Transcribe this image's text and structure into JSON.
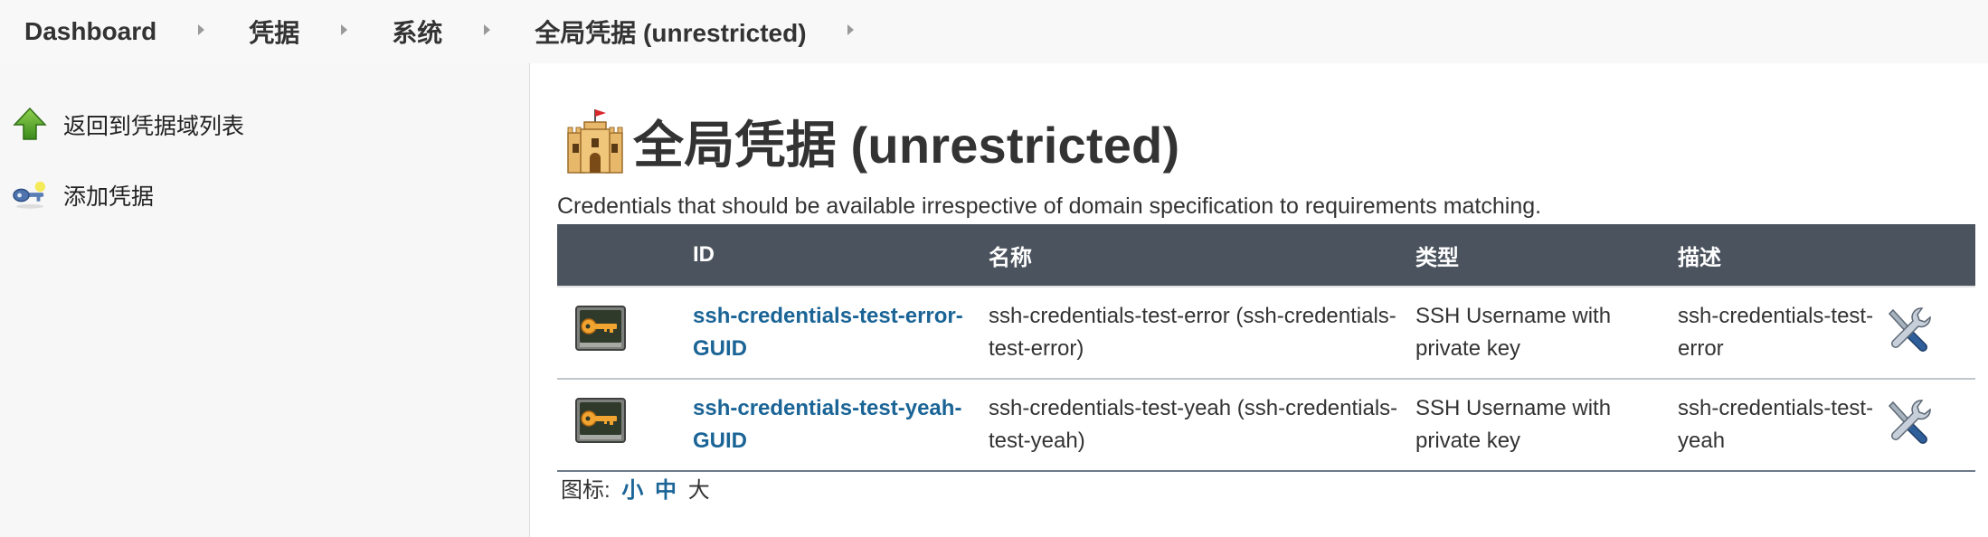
{
  "breadcrumb": [
    "Dashboard",
    "凭据",
    "系统",
    "全局凭据 (unrestricted)"
  ],
  "sidebar": {
    "items": [
      {
        "label": "返回到凭据域列表",
        "icon": "green-up-arrow-icon"
      },
      {
        "label": "添加凭据",
        "icon": "key-icon"
      }
    ]
  },
  "main": {
    "title": "全局凭据 (unrestricted)",
    "description": "Credentials that should be available irrespective of domain specification to requirements matching.",
    "table": {
      "headers": [
        "ID",
        "名称",
        "类型",
        "描述"
      ],
      "rows": [
        {
          "id": "ssh-credentials-test-error-GUID",
          "name": "ssh-credentials-test-error (ssh-credentials-test-error)",
          "type": "SSH Username with private key",
          "description": "ssh-credentials-test-error"
        },
        {
          "id": "ssh-credentials-test-yeah-GUID",
          "name": "ssh-credentials-test-yeah (ssh-credentials-test-yeah)",
          "type": "SSH Username with private key",
          "description": "ssh-credentials-test-yeah"
        }
      ]
    },
    "icon_size": {
      "label": "图标:",
      "small": "小",
      "medium": "中",
      "large": "大"
    }
  },
  "colors": {
    "header_bg": "#4b535e",
    "link": "#1a6496",
    "sidebar_bg": "#f7f7f7",
    "topbar_bg": "#f8f8f8"
  }
}
